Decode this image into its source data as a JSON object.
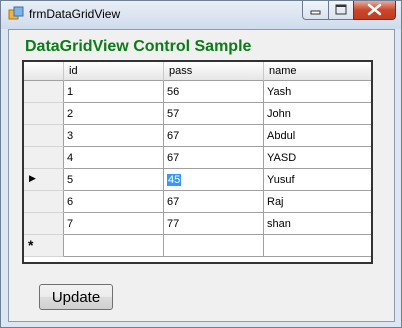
{
  "window": {
    "title": "frmDataGridView"
  },
  "heading": "DataGridView Control Sample",
  "grid": {
    "columns": [
      "id",
      "pass",
      "name"
    ],
    "rows": [
      [
        "1",
        "56",
        "Yash"
      ],
      [
        "2",
        "57",
        "John"
      ],
      [
        "3",
        "67",
        "Abdul"
      ],
      [
        "4",
        "67",
        "YASD"
      ],
      [
        "5",
        "45",
        "Yusuf"
      ],
      [
        "6",
        "67",
        "Raj"
      ],
      [
        "7",
        "77",
        "shan"
      ]
    ],
    "current_row_marker": "▶",
    "new_row_marker": "*",
    "selected_cell": {
      "row": 5,
      "column": "pass"
    }
  },
  "buttons": {
    "update": "Update"
  },
  "colors": {
    "heading": "#0c7b19",
    "selection": "#3399ff"
  }
}
